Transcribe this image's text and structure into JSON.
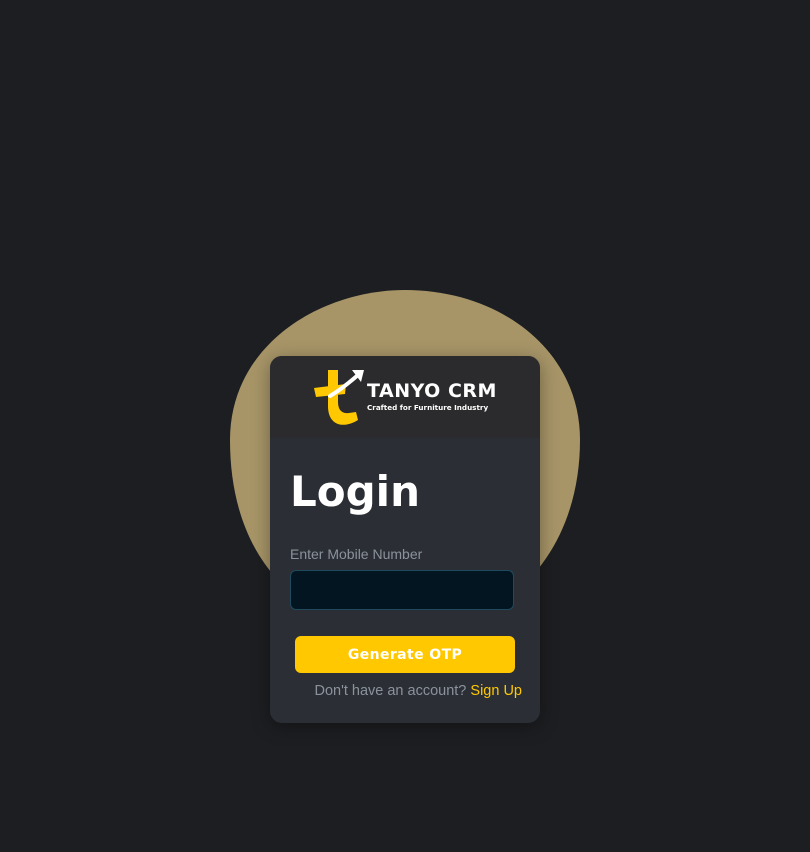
{
  "brand": {
    "name": "TANYO CRM",
    "tagline": "Crafted for Furniture Industry",
    "accent_color": "#ffc800",
    "logo_icon": "tanyo-t-arrow-logo-icon"
  },
  "colors": {
    "background": "#1d1e21",
    "blob": "#a79568",
    "card": "#2b2f35",
    "card_header": "#2b2b2d",
    "input_bg": "#021520"
  },
  "login": {
    "title": "Login",
    "mobile_label": "Enter Mobile Number",
    "mobile_value": "",
    "generate_button": "Generate OTP",
    "no_account_text": "Don't have an account?",
    "signup_link": "Sign Up"
  }
}
